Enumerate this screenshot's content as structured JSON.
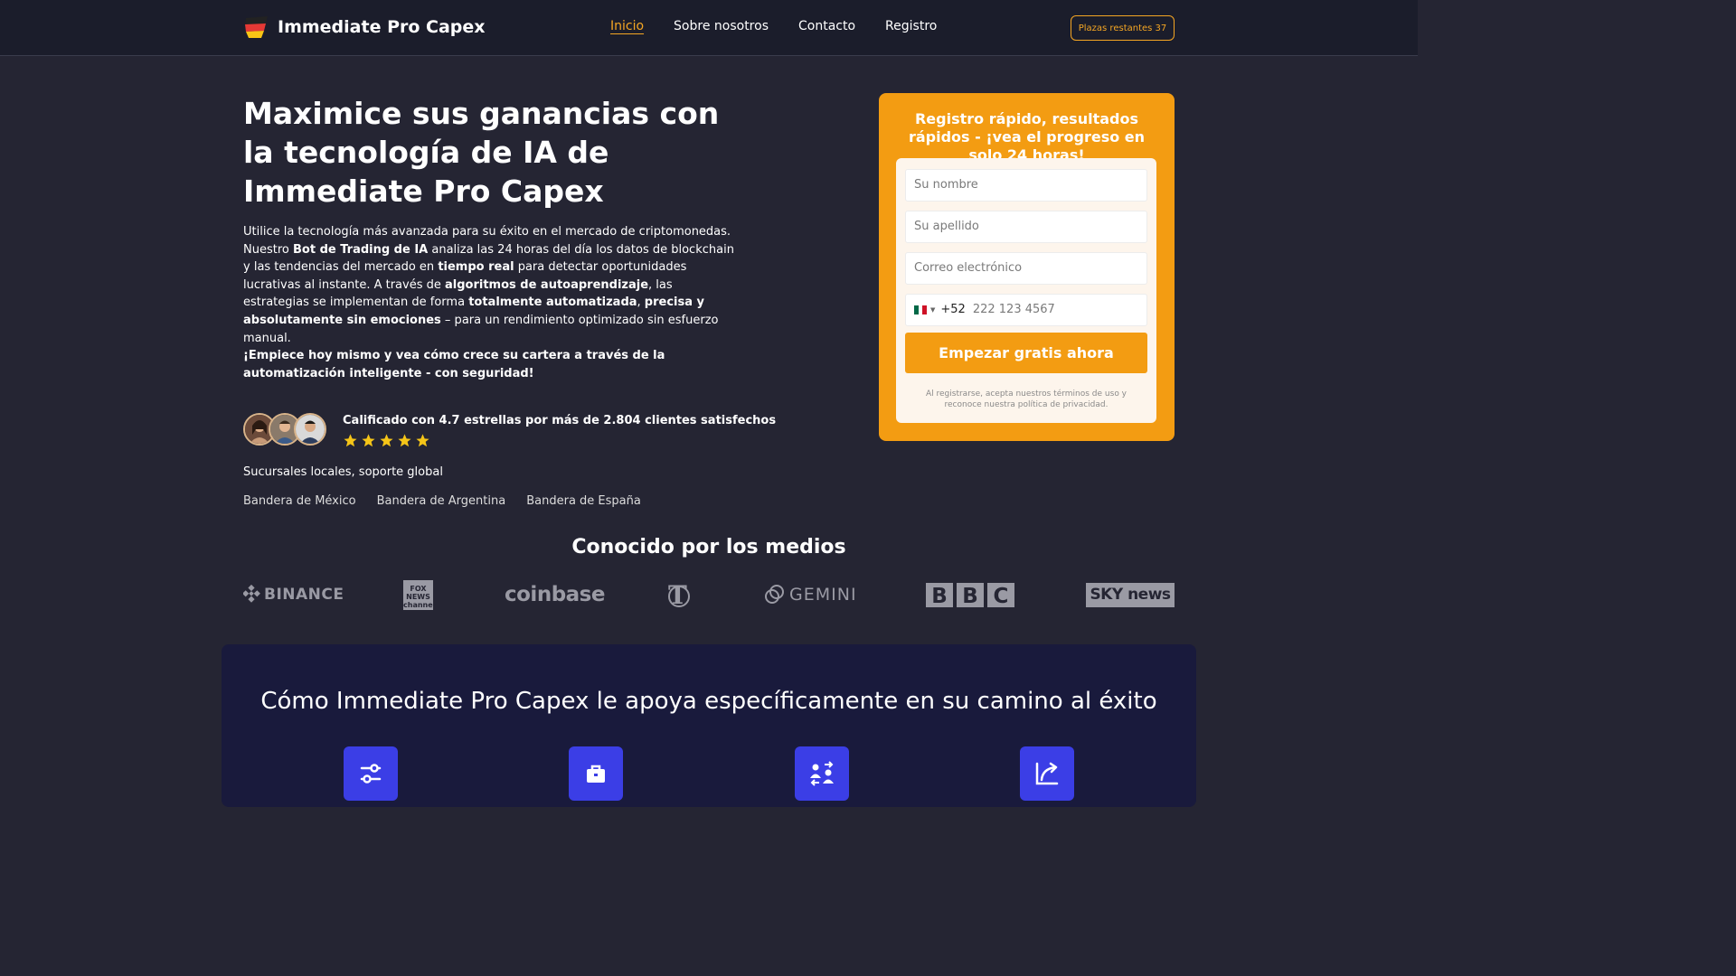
{
  "header": {
    "brand": "Immediate Pro Capex",
    "nav": [
      "Inicio",
      "Sobre nosotros",
      "Contacto",
      "Registro"
    ],
    "slots_label": "Plazas restantes 37"
  },
  "hero": {
    "title": "Maximice sus ganancias con la tecnología de IA de Immediate Pro Capex",
    "paragraph": [
      {
        "text": "Utilice la tecnología más avanzada para su éxito en el mercado de criptomonedas. Nuestro ",
        "bold": false
      },
      {
        "text": "Bot de Trading de IA",
        "bold": true
      },
      {
        "text": " analiza las 24 horas del día los datos de blockchain y las tendencias del mercado en ",
        "bold": false
      },
      {
        "text": "tiempo real",
        "bold": true
      },
      {
        "text": " para detectar oportunidades lucrativas al instante. A través de ",
        "bold": false
      },
      {
        "text": "algoritmos de autoaprendizaje",
        "bold": true
      },
      {
        "text": ", las estrategias se implementan de forma ",
        "bold": false
      },
      {
        "text": "totalmente automatizada",
        "bold": true
      },
      {
        "text": ", ",
        "bold": false
      },
      {
        "text": "precisa y absolutamente sin emociones",
        "bold": true
      },
      {
        "text": " – para un rendimiento optimizado sin esfuerzo manual.",
        "bold": false
      }
    ],
    "cta": "¡Empiece hoy mismo y vea cómo crece su cartera a través de la automatización inteligente - con seguridad!",
    "rating_text": "Calificado con 4.7 estrellas por más de 2.804 clientes satisfechos",
    "stars": 5,
    "branches": "Sucursales locales, soporte global",
    "flags": [
      "Bandera de México",
      "Bandera de Argentina",
      "Bandera de España"
    ]
  },
  "form": {
    "title": "Registro rápido, resultados rápidos - ¡vea el progreso en solo 24 horas!",
    "first_name_placeholder": "Su nombre",
    "last_name_placeholder": "Su apellido",
    "email_placeholder": "Correo electrónico",
    "dial_code": "+52",
    "phone_placeholder": "222 123 4567",
    "submit_label": "Empezar gratis ahora",
    "terms": "Al registrarse, acepta nuestros términos de uso y reconoce nuestra política de privacidad."
  },
  "media": {
    "title": "Conocido por los medios",
    "logos": [
      "BINANCE",
      "FOX NEWS channel",
      "coinbase",
      "New York Times",
      "GEMINI",
      "BBC",
      "SKY news"
    ]
  },
  "section": {
    "title": "Cómo Immediate Pro Capex le apoya específicamente en su camino al éxito",
    "icons": [
      "sliders-icon",
      "briefcase-icon",
      "exchange-users-icon",
      "growth-arrow-icon"
    ]
  },
  "colors": {
    "accent": "#f39c12",
    "background": "#252533",
    "header": "#1b1d2b",
    "section": "#191a3c",
    "feature_icon": "#3b3ee6"
  }
}
